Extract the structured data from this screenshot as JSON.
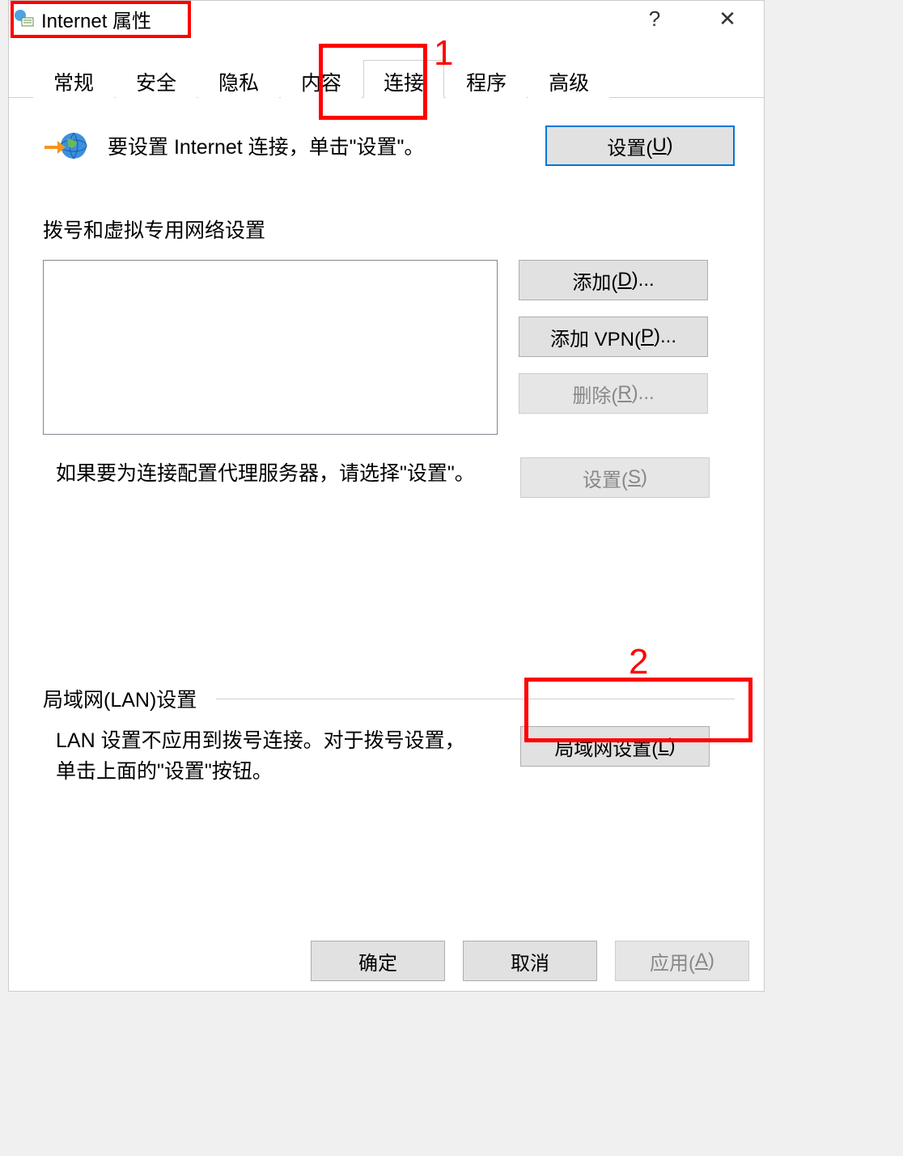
{
  "titlebar": {
    "title": "Internet 属性",
    "help_label": "?",
    "close_label": "✕"
  },
  "tabs": {
    "general": "常规",
    "security": "安全",
    "privacy": "隐私",
    "content": "内容",
    "connections": "连接",
    "programs": "程序",
    "advanced": "高级"
  },
  "content": {
    "setup_text": "要设置 Internet 连接，单击\"设置\"。",
    "setup_button": "设置(U)",
    "dialup_label": "拨号和虚拟专用网络设置",
    "add_button": "添加(D)...",
    "add_vpn_button": "添加 VPN(P)...",
    "remove_button": "删除(R)...",
    "proxy_text": "如果要为连接配置代理服务器，请选择\"设置\"。",
    "settings_button": "设置(S)",
    "lan_label": "局域网(LAN)设置",
    "lan_text": "LAN 设置不应用到拨号连接。对于拨号设置，单击上面的\"设置\"按钮。",
    "lan_button": "局域网设置(L)"
  },
  "footer": {
    "ok": "确定",
    "cancel": "取消",
    "apply": "应用(A)"
  },
  "annotations": {
    "num1": "1",
    "num2": "2"
  }
}
